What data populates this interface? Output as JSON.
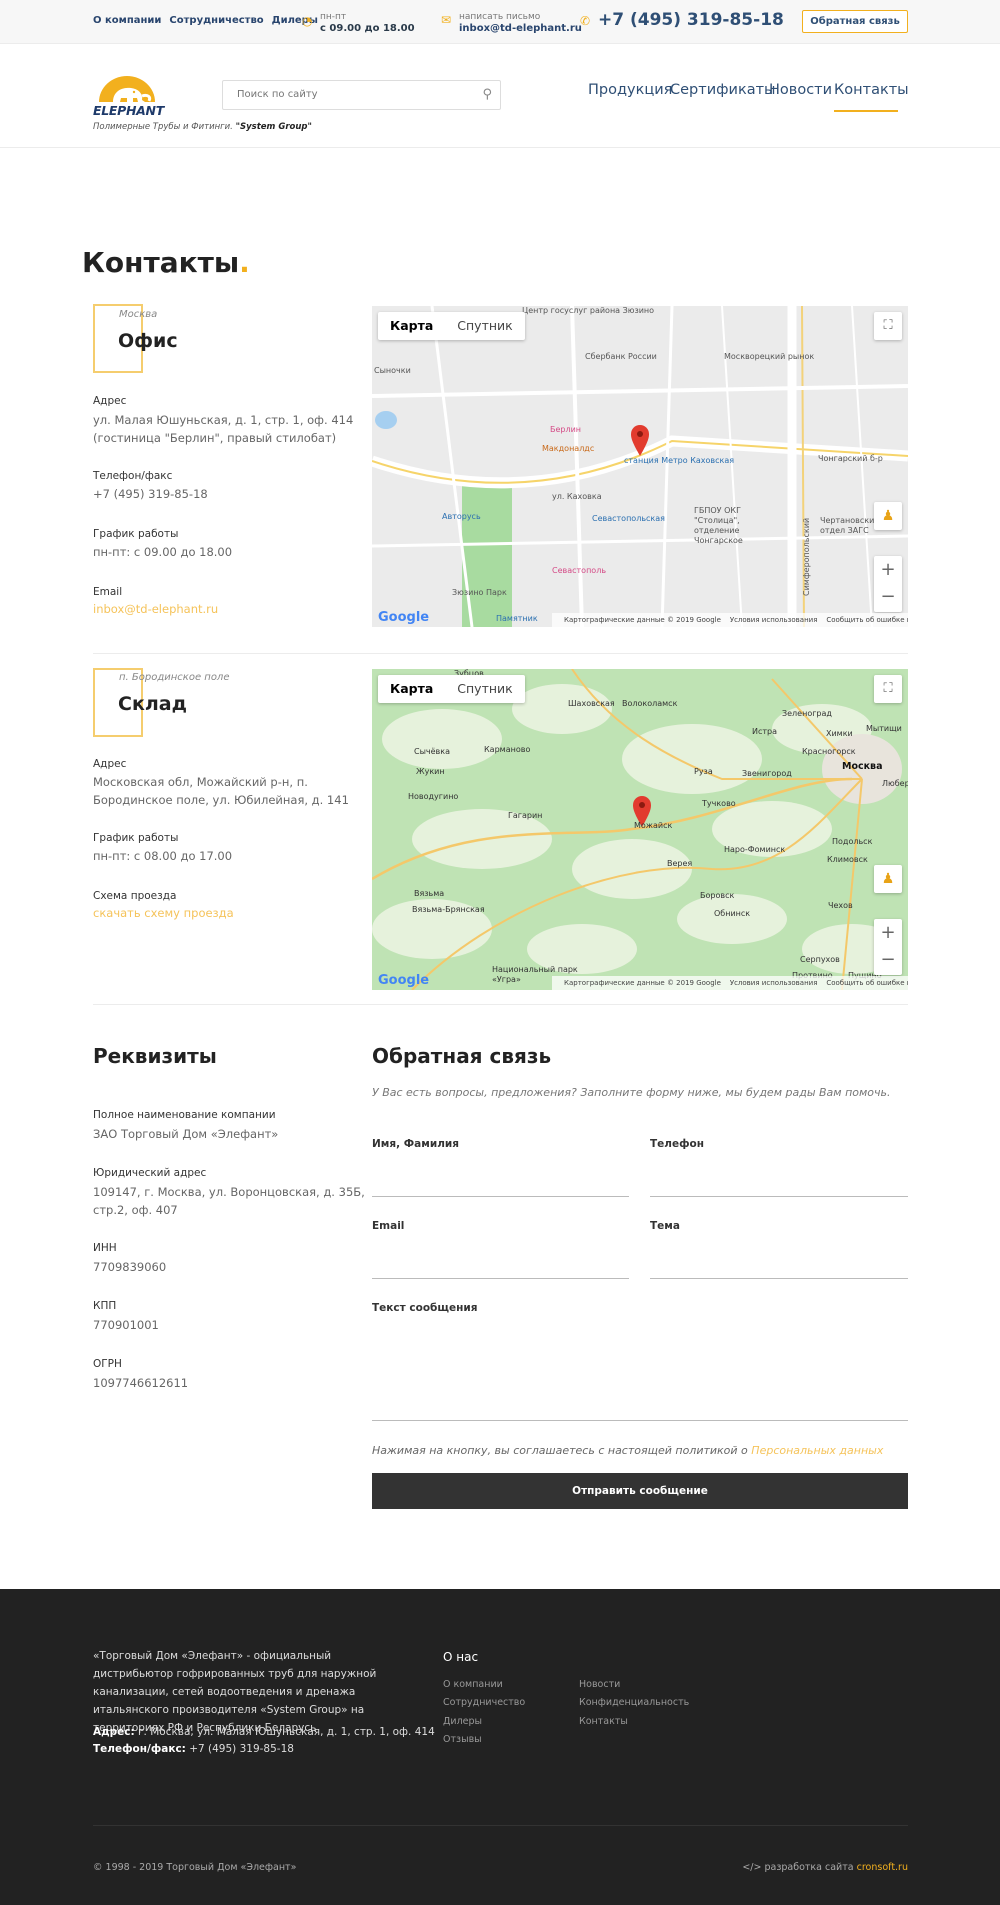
{
  "topbar": {
    "links": [
      "О компании",
      "Сотрудничество",
      "Дилеры"
    ],
    "hours_label": "пн-пт",
    "hours_value": "с 09.00 до 18.00",
    "mail_label": "написать письмо",
    "mail_value": "inbox@td-elephant.ru",
    "phone": "+7 (495) 319-85-18",
    "feedback_button": "Обратная связь",
    "accent_color": "#f2b01e"
  },
  "header": {
    "logo_text": "ELEPHANT",
    "tagline_prefix": "Полимерные Трубы и Фитинги.",
    "tagline_brand": "\"System Group\"",
    "search_placeholder": "Поиск по сайту",
    "nav": [
      "Продукция",
      "Сертификаты",
      "Новости",
      "Контакты"
    ],
    "nav_active": "Контакты"
  },
  "page": {
    "title": "Контакты",
    "title_dot": "."
  },
  "office": {
    "city": "Москва",
    "title": "Офис",
    "address_label": "Адрес",
    "address_line1": "ул. Малая Юшуньская, д. 1, стр. 1, оф. 414",
    "address_line2": "(гостиница \"Берлин\", правый стилобат)",
    "phone_label": "Телефон/факс",
    "phone_value": "+7 (495) 319-85-18",
    "hours_label": "График работы",
    "hours_value": "пн-пт: с 09.00 до 18.00",
    "email_label": "Email",
    "email_value": "inbox@td-elephant.ru"
  },
  "warehouse": {
    "city": "п. Бородинское поле",
    "title": "Склад",
    "address_label": "Адрес",
    "address_line1": "Московская обл, Можайский р-н, п.",
    "address_line2": "Бородинское поле, ул. Юбилейная, д. 141",
    "hours_label": "График работы",
    "hours_value": "пн-пт: с 08.00 до 17.00",
    "scheme_label": "Схема проезда",
    "scheme_link": "скачать схему проезда"
  },
  "map_common": {
    "tab_map": "Карта",
    "tab_satellite": "Спутник",
    "google": "Google",
    "footer_data": "Картографические данные © 2019 Google",
    "footer_terms": "Условия использования",
    "footer_report": "Сообщить об ошибке на карте"
  },
  "map1_labels": [
    "Центр госуслуг района Зюзино",
    "Сбербанк России",
    "Москворецкий рынок",
    "Сыночки",
    "Берлин",
    "Макдоналдс",
    "станция Метро Каховская",
    "ул. Каховка",
    "Чонгарский б-р",
    "Авторусь",
    "Севастопольская",
    "ГБПОУ ОКГ \"Столица\", отделение Чонгарское",
    "Чертановский отдел ЗАГС",
    "Севастополь",
    "Зюзино Парк",
    "Памятник",
    "Симферопольский"
  ],
  "map2_labels": [
    "Зубцов",
    "Шаховская",
    "Волоколамск",
    "Зеленоград",
    "Химки",
    "Мытищи",
    "Истра",
    "Красногорск",
    "Сычёвка",
    "Карманово",
    "Руза",
    "Звенигород",
    "Москва",
    "Люберцы",
    "Жукин",
    "Новодугино",
    "Тучково",
    "Можайск",
    "Гагарин",
    "Наро-Фоминск",
    "Подольск",
    "Верея",
    "Климовск",
    "Вязьма",
    "Боровск",
    "Обнинск",
    "Чехов",
    "Вязьма-Брянская",
    "Серпухов",
    "Национальный парк «Угра»",
    "Протвино",
    "Пущино"
  ],
  "requisites": {
    "title": "Реквизиты",
    "name_label": "Полное наименование компании",
    "name_value": "ЗАО Торговый Дом «Элефант»",
    "legal_label": "Юридический адрес",
    "legal_line1": "109147, г. Москва, ул. Воронцовская, д. 35Б,",
    "legal_line2": "стр.2, оф. 407",
    "inn_label": "ИНН",
    "inn_value": "7709839060",
    "kpp_label": "КПП",
    "kpp_value": "770901001",
    "ogrn_label": "ОГРН",
    "ogrn_value": "1097746612611"
  },
  "feedback": {
    "title": "Обратная связь",
    "intro": "У Вас есть вопросы, предложения? Заполните форму ниже, мы будем рады Вам помочь.",
    "name_label": "Имя, Фамилия",
    "phone_label": "Телефон",
    "email_label": "Email",
    "subject_label": "Тема",
    "message_label": "Текст сообщения",
    "consent_text": "Нажимая на кнопку, вы соглашаетесь с настоящей политикой о",
    "consent_link": "Персональных данных",
    "submit": "Отправить сообщение"
  },
  "footer": {
    "description": "«Торговый Дом «Элефант» - официальный дистрибьютор гофрированных труб для наружной канализации, сетей водоотведения и дренажа итальянского производителя «System Group» на территориях РФ и Республики Беларусь",
    "address_label": "Адрес:",
    "address_value": "г. Москва, ул. Малая Юшуньская, д. 1, стр. 1, оф. 414",
    "phone_label": "Телефон/факс:",
    "phone_value": "+7 (495) 319-85-18",
    "about_title": "О нас",
    "col1": [
      "О компании",
      "Сотрудничество",
      "Дилеры",
      "Отзывы"
    ],
    "col2": [
      "Новости",
      "Конфиденциальность",
      "Контакты"
    ],
    "copyright": "© 1998 - 2019 Торговый Дом «Элефант»",
    "dev_prefix": "разработка сайта",
    "dev_link": "cronsoft.ru",
    "dev_icon": "code-icon"
  }
}
